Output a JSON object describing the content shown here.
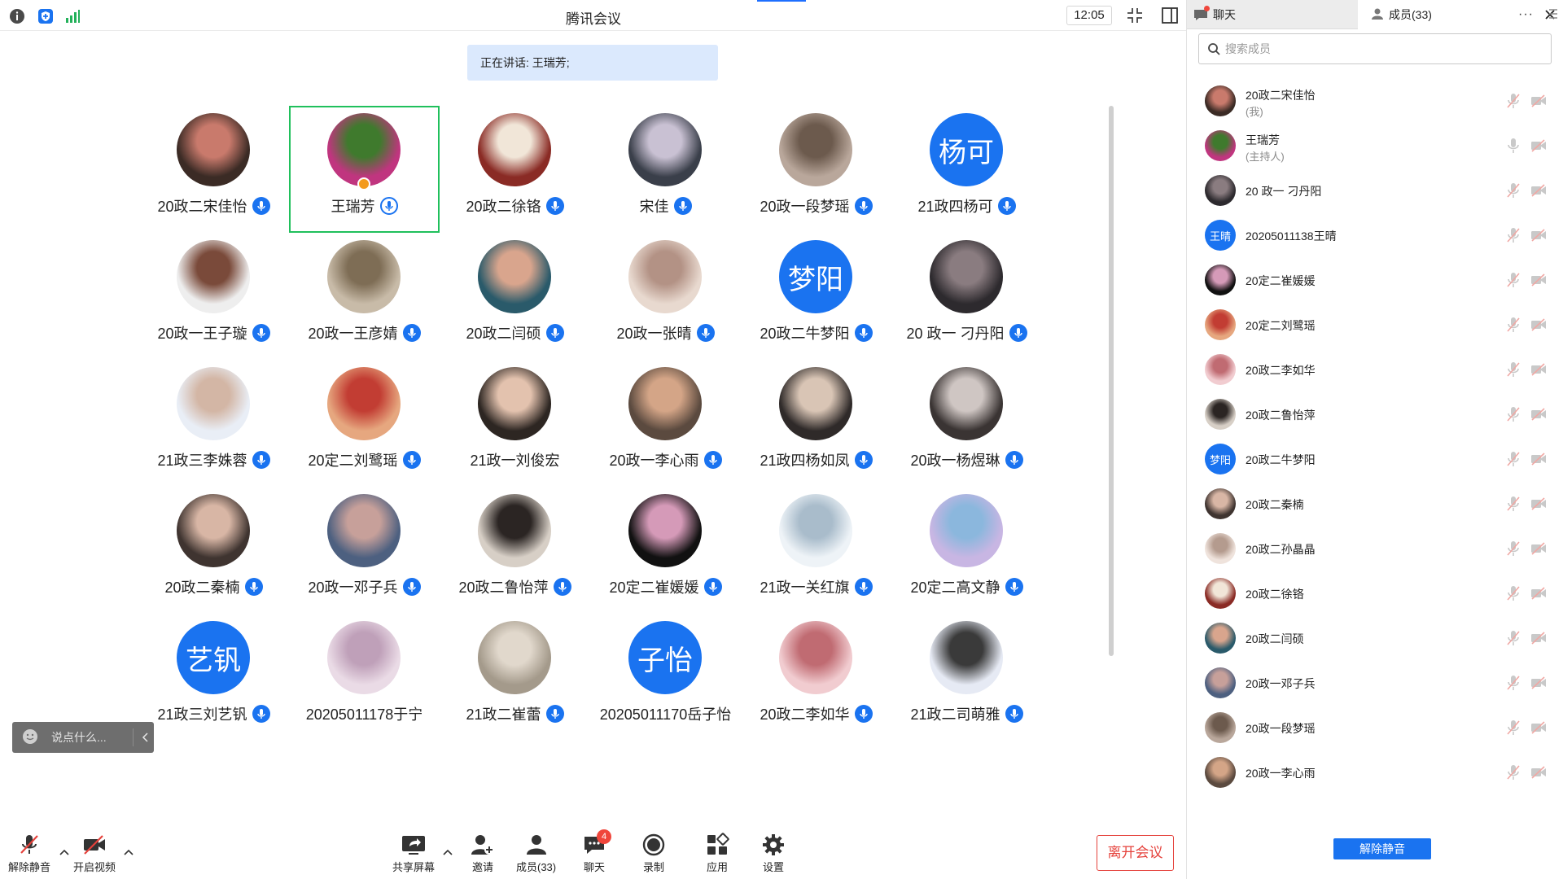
{
  "window": {
    "title": "腾讯会议",
    "clock": "12:05"
  },
  "speaking": "正在讲话: 王瑞芳;",
  "chat_input": {
    "placeholder": "说点什么..."
  },
  "colors": {
    "accent": "#1a73f0",
    "selected_border": "#20c05c",
    "leave": "#e5413b",
    "badge": "#f0463b"
  },
  "participants": [
    {
      "name": "20政二宋佳怡",
      "avatar": "photo",
      "c1": "#3b2b25",
      "c2": "#c97a6c",
      "mic": "filled"
    },
    {
      "name": "王瑞芳",
      "avatar": "photo",
      "c1": "#c0357f",
      "c2": "#3f7a2d",
      "mic": "outline",
      "selected": true,
      "host": true
    },
    {
      "name": "20政二徐铬",
      "avatar": "photo",
      "c1": "#8a2b25",
      "c2": "#f1e6d8",
      "mic": "filled"
    },
    {
      "name": "宋佳",
      "avatar": "photo",
      "c1": "#3a3f4a",
      "c2": "#c9c1d3",
      "mic": "filled"
    },
    {
      "name": "20政一段梦瑶",
      "avatar": "photo",
      "c1": "#b9a79b",
      "c2": "#6c5a4d",
      "mic": "filled"
    },
    {
      "name": "21政四杨可",
      "avatar": "initial",
      "initial": "杨可",
      "mic": "filled"
    },
    {
      "name": "20政一王子璇",
      "avatar": "photo",
      "c1": "#eeeeee",
      "c2": "#7a4a3a",
      "mic": "filled"
    },
    {
      "name": "20政一王彦婧",
      "avatar": "photo",
      "c1": "#c8bba8",
      "c2": "#7e6d55",
      "mic": "filled"
    },
    {
      "name": "20政二闫硕",
      "avatar": "photo",
      "c1": "#2a5a6a",
      "c2": "#d9a58d",
      "mic": "filled"
    },
    {
      "name": "20政一张晴",
      "avatar": "photo",
      "c1": "#e8d9cf",
      "c2": "#b39285",
      "mic": "filled"
    },
    {
      "name": "20政二牛梦阳",
      "avatar": "initial",
      "initial": "梦阳",
      "mic": "filled"
    },
    {
      "name": "20 政一 刁丹阳",
      "avatar": "photo",
      "c1": "#2d2a2e",
      "c2": "#8a7c80",
      "mic": "filled"
    },
    {
      "name": "21政三李姝蓉",
      "avatar": "photo",
      "c1": "#e9eef6",
      "c2": "#d3b6a5",
      "mic": "filled"
    },
    {
      "name": "20定二刘鹭瑶",
      "avatar": "photo",
      "c1": "#e6a77f",
      "c2": "#c23d33",
      "mic": "filled"
    },
    {
      "name": "21政一刘俊宏",
      "avatar": "photo",
      "c1": "#2d2622",
      "c2": "#e3c2ae",
      "mic": "none"
    },
    {
      "name": "20政一李心雨",
      "avatar": "photo",
      "c1": "#5b4a3f",
      "c2": "#d4a587",
      "mic": "filled"
    },
    {
      "name": "21政四杨如凤",
      "avatar": "photo",
      "c1": "#2f2a29",
      "c2": "#d9c5b5",
      "mic": "filled"
    },
    {
      "name": "20政一杨煜琳",
      "avatar": "photo",
      "c1": "#3a3433",
      "c2": "#cfc6c3",
      "mic": "filled"
    },
    {
      "name": "20政二秦楠",
      "avatar": "photo",
      "c1": "#3f3430",
      "c2": "#d8b6a5",
      "mic": "filled"
    },
    {
      "name": "20政一邓子兵",
      "avatar": "photo",
      "c1": "#4d6080",
      "c2": "#c7a09a",
      "mic": "filled"
    },
    {
      "name": "20政二鲁怡萍",
      "avatar": "photo",
      "c1": "#d7cfc6",
      "c2": "#2b2523",
      "mic": "filled"
    },
    {
      "name": "20定二崔媛媛",
      "avatar": "photo",
      "c1": "#111111",
      "c2": "#d59ab8",
      "mic": "filled"
    },
    {
      "name": "21政一关红旗",
      "avatar": "photo",
      "c1": "#eef3f7",
      "c2": "#a9bccb",
      "mic": "filled"
    },
    {
      "name": "20定二高文静",
      "avatar": "photo",
      "c1": "#c8b6e3",
      "c2": "#8bb7dd",
      "mic": "filled"
    },
    {
      "name": "21政三刘艺钒",
      "avatar": "initial",
      "initial": "艺钒",
      "mic": "filled"
    },
    {
      "name": "20205011178于宁",
      "avatar": "photo",
      "c1": "#eadbe6",
      "c2": "#bfa0b9",
      "mic": "none"
    },
    {
      "name": "21政二崔蕾",
      "avatar": "photo",
      "c1": "#a49a8b",
      "c2": "#e1d8cc",
      "mic": "filled"
    },
    {
      "name": "20205011170岳子怡",
      "avatar": "initial",
      "initial": "子怡",
      "mic": "none"
    },
    {
      "name": "20政二李如华",
      "avatar": "photo",
      "c1": "#f1ccd0",
      "c2": "#c06b72",
      "mic": "filled"
    },
    {
      "name": "21政二司萌雅",
      "avatar": "photo",
      "c1": "#e6eaf4",
      "c2": "#3a3a3a",
      "mic": "filled"
    }
  ],
  "toolbar": {
    "unmute": "解除静音",
    "video": "开启视频",
    "share": "共享屏幕",
    "invite": "邀请",
    "members": "成员(33)",
    "chat": "聊天",
    "chat_badge": "4",
    "record": "录制",
    "apps": "应用",
    "settings": "设置",
    "leave": "离开会议"
  },
  "side": {
    "tab_chat": "聊天",
    "tab_members": "成员(33)",
    "search_placeholder": "搜索成员",
    "unmute_all": "解除静音",
    "members": [
      {
        "name": "20政二宋佳怡",
        "role": "(我)",
        "avatar": "photo",
        "c1": "#3b2b25",
        "c2": "#c97a6c",
        "muted": true
      },
      {
        "name": "王瑞芳",
        "role": "(主持人)",
        "avatar": "photo",
        "c1": "#c0357f",
        "c2": "#3f7a2d",
        "muted": false
      },
      {
        "name": "20 政一 刁丹阳",
        "avatar": "photo",
        "c1": "#2d2a2e",
        "c2": "#8a7c80",
        "muted": true
      },
      {
        "name": "20205011138王晴",
        "avatar": "initial",
        "initial": "王晴",
        "muted": true
      },
      {
        "name": "20定二崔媛媛",
        "avatar": "photo",
        "c1": "#111111",
        "c2": "#d59ab8",
        "muted": true
      },
      {
        "name": "20定二刘鹭瑶",
        "avatar": "photo",
        "c1": "#e6a77f",
        "c2": "#c23d33",
        "muted": true
      },
      {
        "name": "20政二李如华",
        "avatar": "photo",
        "c1": "#f1ccd0",
        "c2": "#c06b72",
        "muted": true
      },
      {
        "name": "20政二鲁怡萍",
        "avatar": "photo",
        "c1": "#d7cfc6",
        "c2": "#2b2523",
        "muted": true
      },
      {
        "name": "20政二牛梦阳",
        "avatar": "initial",
        "initial": "梦阳",
        "muted": true
      },
      {
        "name": "20政二秦楠",
        "avatar": "photo",
        "c1": "#3f3430",
        "c2": "#d8b6a5",
        "muted": true
      },
      {
        "name": "20政二孙晶晶",
        "avatar": "photo",
        "c1": "#efe3dc",
        "c2": "#b49b8e",
        "muted": true
      },
      {
        "name": "20政二徐铬",
        "avatar": "photo",
        "c1": "#8a2b25",
        "c2": "#f1e6d8",
        "muted": true
      },
      {
        "name": "20政二闫硕",
        "avatar": "photo",
        "c1": "#2a5a6a",
        "c2": "#d9a58d",
        "muted": true
      },
      {
        "name": "20政一邓子兵",
        "avatar": "photo",
        "c1": "#4d6080",
        "c2": "#c7a09a",
        "muted": true
      },
      {
        "name": "20政一段梦瑶",
        "avatar": "photo",
        "c1": "#b9a79b",
        "c2": "#6c5a4d",
        "muted": true
      },
      {
        "name": "20政一李心雨",
        "avatar": "photo",
        "c1": "#5b4a3f",
        "c2": "#d4a587",
        "muted": true
      }
    ]
  }
}
